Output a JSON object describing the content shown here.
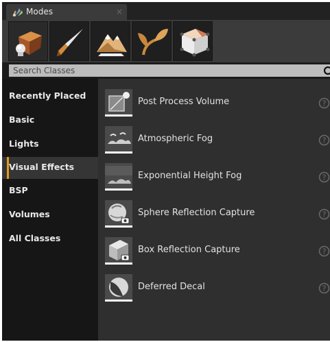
{
  "window": {
    "tab_title": "Modes",
    "tab_close": "×",
    "tab_icon": "modes-icon"
  },
  "toolbar": {
    "modes": [
      {
        "name": "place-mode",
        "icon": "cube-sphere-icon",
        "active": true
      },
      {
        "name": "paint-mode",
        "icon": "paint-brush-icon"
      },
      {
        "name": "landscape-mode",
        "icon": "mountain-icon"
      },
      {
        "name": "foliage-mode",
        "icon": "leaf-icon"
      },
      {
        "name": "geometry-edit-mode",
        "icon": "box-edit-icon"
      }
    ]
  },
  "search": {
    "placeholder": "Search Classes",
    "value": "",
    "icon": "search-icon"
  },
  "sidebar": {
    "active_index": 3,
    "accent": "#e59b1d",
    "items": [
      {
        "label": "Recently Placed"
      },
      {
        "label": "Basic"
      },
      {
        "label": "Lights"
      },
      {
        "label": "Visual Effects"
      },
      {
        "label": "BSP"
      },
      {
        "label": "Volumes"
      },
      {
        "label": "All Classes"
      }
    ]
  },
  "list": {
    "items": [
      {
        "label": "Post Process Volume",
        "icon": "post-process-volume-icon"
      },
      {
        "label": "Atmospheric Fog",
        "icon": "atmospheric-fog-icon"
      },
      {
        "label": "Exponential Height Fog",
        "icon": "exponential-height-fog-icon"
      },
      {
        "label": "Sphere Reflection Capture",
        "icon": "sphere-reflection-capture-icon"
      },
      {
        "label": "Box Reflection Capture",
        "icon": "box-reflection-capture-icon"
      },
      {
        "label": "Deferred Decal",
        "icon": "deferred-decal-icon"
      }
    ],
    "help_icon": "help-icon"
  }
}
